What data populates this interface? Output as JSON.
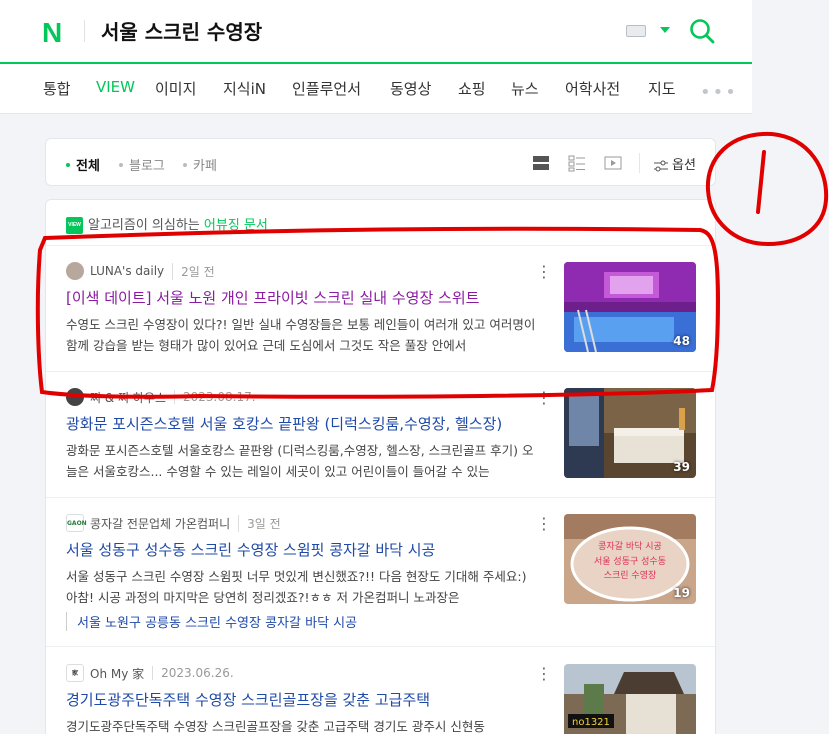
{
  "header": {
    "logo": "N",
    "query": "서울 스크린 수영장",
    "accent": "#03c75a"
  },
  "tabs": [
    "통합",
    "VIEW",
    "이미지",
    "지식iN",
    "인플루언서",
    "동영상",
    "쇼핑",
    "뉴스",
    "어학사전",
    "지도"
  ],
  "tab_more": "•••",
  "filters": {
    "chips": [
      "전체",
      "블로그",
      "카페"
    ],
    "options_label": "옵션",
    "icons": [
      "list-view-icon",
      "grid-view-icon",
      "video-view-icon",
      "options-icon"
    ]
  },
  "algo_notice": {
    "badge": "VIEW",
    "prefix": "알고리즘이 의심하는 ",
    "highlight": "어뷰징 문서"
  },
  "posts": [
    {
      "author": "LUNA's daily",
      "date": "2일 전",
      "title": "[이색 데이트] 서울 노원 개인 프라이빗 스크린 실내 수영장 스위트",
      "desc": "수영도 스크린 수영장이 있다?! 일반 실내 수영장들은 보통 레인들이 여러개 있고 여러명이 함께 강습을 받는 형태가 많이 있어요 근데 도심에서 그것도 작은 풀장 안에서",
      "thumb_count": "48",
      "visited": true
    },
    {
      "author": "찌 & 찌 하우스",
      "date": "2023.08.17.",
      "title": "광화문 포시즌스호텔 서울 호캉스 끝판왕 (디럭스킹룸,수영장, 헬스장)",
      "desc": "광화문 포시즌스호텔 서울호캉스 끝판왕 (디럭스킹룸,수영장, 헬스장, 스크린골프 후기) 오늘은 서울호캉스... 수영할 수 있는 레일이 세곳이 있고 어린이들이 들어갈 수 있는",
      "thumb_count": "39",
      "visited": false
    },
    {
      "author": "콩자갈 전문업체 가온컴퍼니",
      "date": "3일 전",
      "title": "서울 성동구 성수동 스크린 수영장 스윔핏 콩자갈 바닥 시공",
      "desc": "서울 성동구 스크린 수영장 스윔핏 너무 멋있게 변신했죠?!! 다음 현장도 기대해 주세요:) 아참! 시공 과정의 마지막은 당연히 정리겠죠?!ㅎㅎ 저 가온컴퍼니 노과장은",
      "related": "서울 노원구 공릉동 스크린 수영장 콩자갈 바닥 시공",
      "thumb_count": "19",
      "thumb_text": "콩자갈 바닥 시공 서울 성동구 성수동 스크린 수영장",
      "visited": false
    },
    {
      "author": "Oh My 家",
      "date": "2023.06.26.",
      "title": "경기도광주단독주택 수영장 스크린골프장을 갖춘 고급주택",
      "desc": "경기도광주단독주택 수영장 스크린골프장을 갖춘 고급주택 경기도 광주시 신현동",
      "thumb_count": "",
      "thumb_text": "no1321",
      "visited": false
    }
  ],
  "annotation": {
    "label": "!",
    "color": "#e00000"
  }
}
